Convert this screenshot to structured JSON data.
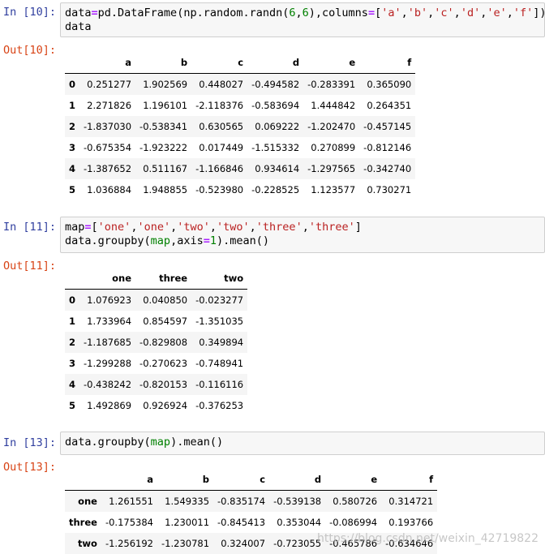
{
  "cells": [
    {
      "in_prompt": "In [10]:",
      "out_prompt": "Out[10]:",
      "code_lines": [
        [
          [
            "p",
            "data"
          ],
          [
            "op",
            "="
          ],
          [
            "p",
            "pd.DataFrame(np.random.randn("
          ],
          [
            "num",
            "6"
          ],
          [
            "p",
            ","
          ],
          [
            "num",
            "6"
          ],
          [
            "p",
            "),columns"
          ],
          [
            "op",
            "="
          ],
          [
            "p",
            "["
          ],
          [
            "str",
            "'a'"
          ],
          [
            "p",
            ","
          ],
          [
            "str",
            "'b'"
          ],
          [
            "p",
            ","
          ],
          [
            "str",
            "'c'"
          ],
          [
            "p",
            ","
          ],
          [
            "str",
            "'d'"
          ],
          [
            "p",
            ","
          ],
          [
            "str",
            "'e'"
          ],
          [
            "p",
            ","
          ],
          [
            "str",
            "'f'"
          ],
          [
            "p",
            "])"
          ]
        ],
        [
          [
            "p",
            "data"
          ]
        ]
      ],
      "table": {
        "columns": [
          "",
          "a",
          "b",
          "c",
          "d",
          "e",
          "f"
        ],
        "rows": [
          [
            "0",
            "0.251277",
            "1.902569",
            "0.448027",
            "-0.494582",
            "-0.283391",
            "0.365090"
          ],
          [
            "1",
            "2.271826",
            "1.196101",
            "-2.118376",
            "-0.583694",
            "1.444842",
            "0.264351"
          ],
          [
            "2",
            "-1.837030",
            "-0.538341",
            "0.630565",
            "0.069222",
            "-1.202470",
            "-0.457145"
          ],
          [
            "3",
            "-0.675354",
            "-1.923222",
            "0.017449",
            "-1.515332",
            "0.270899",
            "-0.812146"
          ],
          [
            "4",
            "-1.387652",
            "0.511167",
            "-1.166846",
            "0.934614",
            "-1.297565",
            "-0.342740"
          ],
          [
            "5",
            "1.036884",
            "1.948855",
            "-0.523980",
            "-0.228525",
            "1.123577",
            "0.730271"
          ]
        ]
      }
    },
    {
      "in_prompt": "In [11]:",
      "out_prompt": "Out[11]:",
      "code_lines": [
        [
          [
            "p",
            "map"
          ],
          [
            "op",
            "="
          ],
          [
            "p",
            "["
          ],
          [
            "str",
            "'one'"
          ],
          [
            "p",
            ","
          ],
          [
            "str",
            "'one'"
          ],
          [
            "p",
            ","
          ],
          [
            "str",
            "'two'"
          ],
          [
            "p",
            ","
          ],
          [
            "str",
            "'two'"
          ],
          [
            "p",
            ","
          ],
          [
            "str",
            "'three'"
          ],
          [
            "p",
            ","
          ],
          [
            "str",
            "'three'"
          ],
          [
            "p",
            "]"
          ]
        ],
        [
          [
            "p",
            "data.groupby("
          ],
          [
            "bi",
            "map"
          ],
          [
            "p",
            ",axis"
          ],
          [
            "op",
            "="
          ],
          [
            "num",
            "1"
          ],
          [
            "p",
            ").mean()"
          ]
        ]
      ],
      "table": {
        "columns": [
          "",
          "one",
          "three",
          "two"
        ],
        "rows": [
          [
            "0",
            "1.076923",
            "0.040850",
            "-0.023277"
          ],
          [
            "1",
            "1.733964",
            "0.854597",
            "-1.351035"
          ],
          [
            "2",
            "-1.187685",
            "-0.829808",
            "0.349894"
          ],
          [
            "3",
            "-1.299288",
            "-0.270623",
            "-0.748941"
          ],
          [
            "4",
            "-0.438242",
            "-0.820153",
            "-0.116116"
          ],
          [
            "5",
            "1.492869",
            "0.926924",
            "-0.376253"
          ]
        ]
      }
    },
    {
      "in_prompt": "In [13]:",
      "out_prompt": "Out[13]:",
      "code_lines": [
        [
          [
            "p",
            "data.groupby("
          ],
          [
            "bi",
            "map"
          ],
          [
            "p",
            ").mean()"
          ]
        ]
      ],
      "table": {
        "columns": [
          "",
          "a",
          "b",
          "c",
          "d",
          "e",
          "f"
        ],
        "rows": [
          [
            "one",
            "1.261551",
            "1.549335",
            "-0.835174",
            "-0.539138",
            "0.580726",
            "0.314721"
          ],
          [
            "three",
            "-0.175384",
            "1.230011",
            "-0.845413",
            "0.353044",
            "-0.086994",
            "0.193766"
          ],
          [
            "two",
            "-1.256192",
            "-1.230781",
            "0.324007",
            "-0.723055",
            "-0.465786",
            "-0.634646"
          ]
        ]
      }
    }
  ],
  "watermark": "https://blog.csdn.net/weixin_42719822"
}
